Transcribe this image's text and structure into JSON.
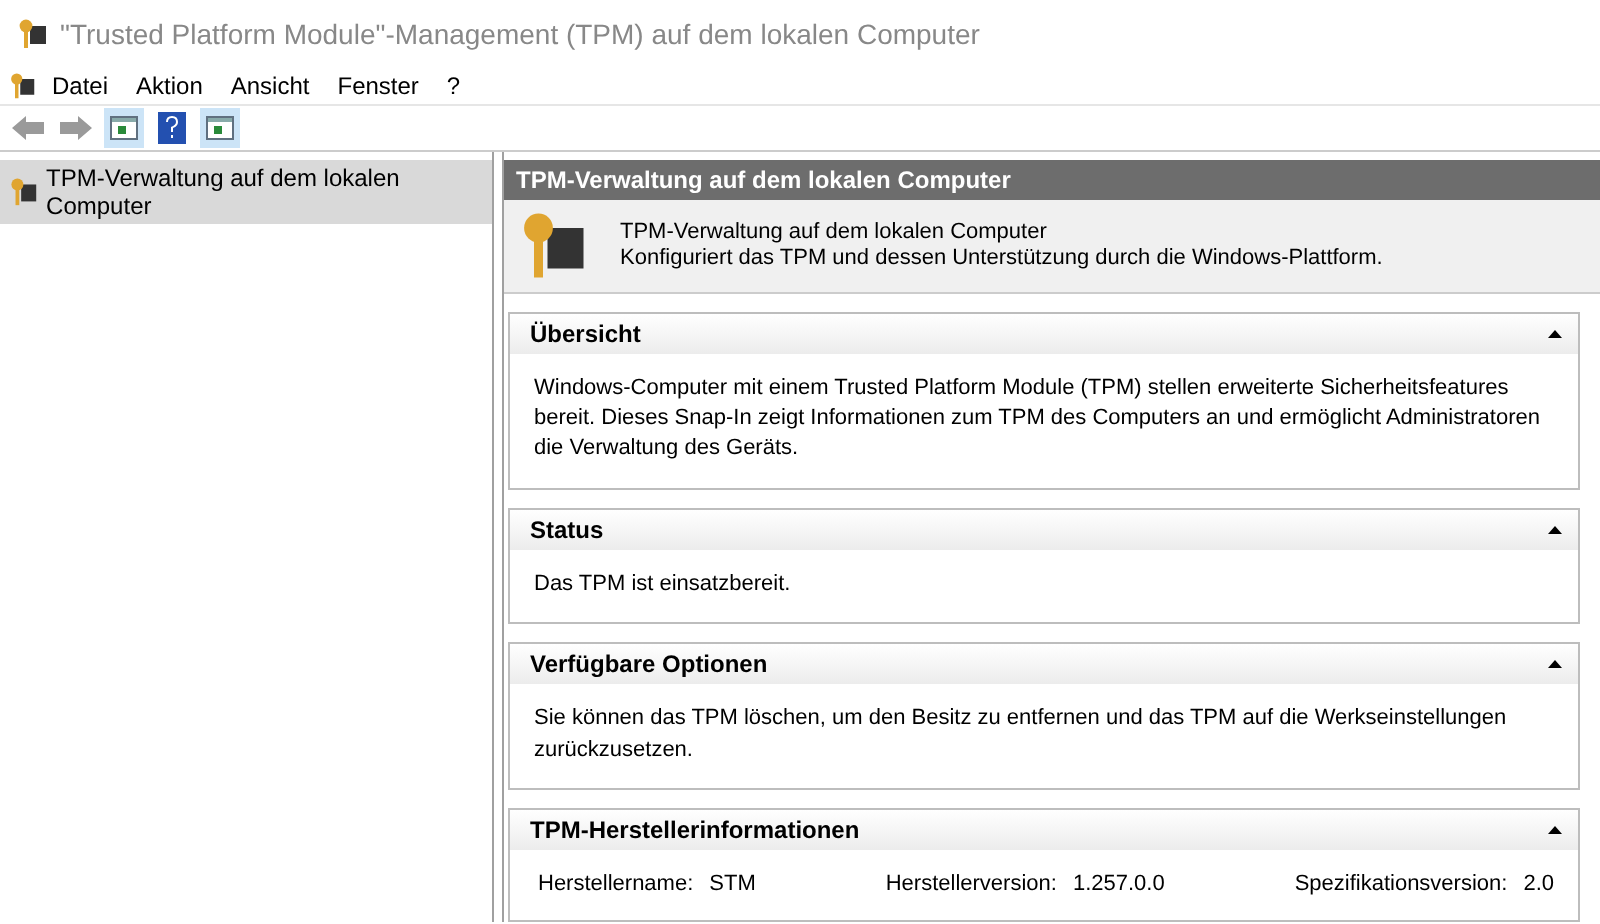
{
  "window": {
    "title": "\"Trusted Platform Module\"-Management (TPM) auf dem lokalen Computer"
  },
  "menu": [
    "Datei",
    "Aktion",
    "Ansicht",
    "Fenster",
    "?"
  ],
  "tree": {
    "items": [
      {
        "label": "TPM-Verwaltung auf dem lokalen Computer",
        "selected": true
      }
    ]
  },
  "pane": {
    "title": "TPM-Verwaltung auf dem lokalen Computer",
    "description": {
      "heading": "TPM-Verwaltung auf dem lokalen Computer",
      "text": "Konfiguriert das TPM und dessen Unterstützung durch die Windows-Plattform."
    },
    "sections": [
      {
        "kind": "text",
        "title": "Übersicht",
        "expanded": true,
        "text": "Windows-Computer mit einem Trusted Platform Module (TPM) stellen erweiterte Sicherheitsfeatures bereit. Dieses Snap-In zeigt Informationen zum TPM des Computers an und ermöglicht Administratoren die Verwaltung des Geräts."
      },
      {
        "kind": "text",
        "title": "Status",
        "expanded": true,
        "text": "Das TPM ist einsatzbereit."
      },
      {
        "kind": "text",
        "title": "Verfügbare Optionen",
        "expanded": true,
        "text": "Sie können das TPM löschen, um den Besitz zu entfernen und das TPM auf die Werkseinstellungen zurückzusetzen."
      },
      {
        "kind": "fields",
        "title": "TPM-Herstellerinformationen",
        "expanded": true,
        "fields": [
          {
            "label": "Herstellername:",
            "value": "STM"
          },
          {
            "label": "Herstellerversion:",
            "value": "1.257.0.0"
          },
          {
            "label": "Spezifikationsversion:",
            "value": "2.0"
          }
        ]
      }
    ]
  }
}
